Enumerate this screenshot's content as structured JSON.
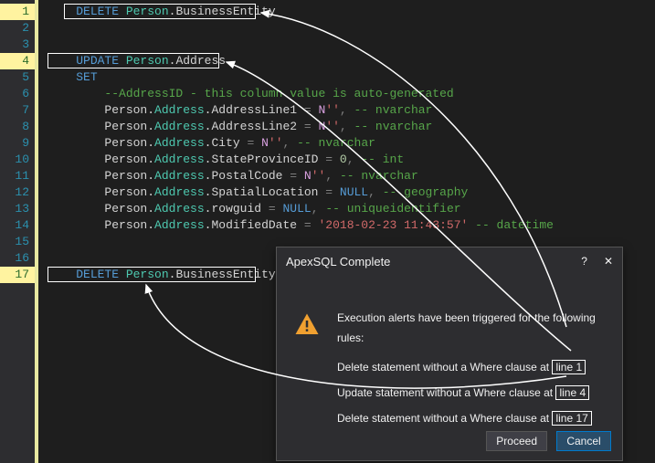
{
  "editor": {
    "lines": [
      {
        "n": 1,
        "hl": true,
        "parts": [
          [
            "    ",
            "kw-white"
          ],
          [
            "DELETE ",
            "kw-blue"
          ],
          [
            "Person",
            "kw-green"
          ],
          [
            ".",
            "kw-white"
          ],
          [
            "BusinessEntity",
            "kw-white"
          ]
        ]
      },
      {
        "n": 2,
        "hl": false,
        "parts": []
      },
      {
        "n": 3,
        "hl": false,
        "parts": []
      },
      {
        "n": 4,
        "hl": true,
        "parts": [
          [
            "    ",
            "kw-white"
          ],
          [
            "UPDATE ",
            "kw-blue"
          ],
          [
            "Person",
            "kw-green"
          ],
          [
            ".",
            "kw-white"
          ],
          [
            "Address",
            "kw-white"
          ]
        ]
      },
      {
        "n": 5,
        "hl": false,
        "parts": [
          [
            "    ",
            "kw-white"
          ],
          [
            "SET",
            "kw-blue"
          ]
        ]
      },
      {
        "n": 6,
        "hl": false,
        "parts": [
          [
            "        ",
            "kw-white"
          ],
          [
            "--AddressID - this column value is auto-generated",
            "kw-comment"
          ]
        ]
      },
      {
        "n": 7,
        "hl": false,
        "parts": [
          [
            "        ",
            "kw-white"
          ],
          [
            "Person",
            "kw-white"
          ],
          [
            ".",
            "kw-white"
          ],
          [
            "Address",
            "kw-green"
          ],
          [
            ".",
            "kw-white"
          ],
          [
            "AddressLine1 ",
            "kw-white"
          ],
          [
            "= ",
            "kw-gray"
          ],
          [
            "N",
            "kw-mag"
          ],
          [
            "''",
            "kw-red"
          ],
          [
            ", ",
            "kw-gray"
          ],
          [
            "-- nvarchar",
            "kw-comment"
          ]
        ]
      },
      {
        "n": 8,
        "hl": false,
        "parts": [
          [
            "        ",
            "kw-white"
          ],
          [
            "Person",
            "kw-white"
          ],
          [
            ".",
            "kw-white"
          ],
          [
            "Address",
            "kw-green"
          ],
          [
            ".",
            "kw-white"
          ],
          [
            "AddressLine2 ",
            "kw-white"
          ],
          [
            "= ",
            "kw-gray"
          ],
          [
            "N",
            "kw-mag"
          ],
          [
            "''",
            "kw-red"
          ],
          [
            ", ",
            "kw-gray"
          ],
          [
            "-- nvarchar",
            "kw-comment"
          ]
        ]
      },
      {
        "n": 9,
        "hl": false,
        "parts": [
          [
            "        ",
            "kw-white"
          ],
          [
            "Person",
            "kw-white"
          ],
          [
            ".",
            "kw-white"
          ],
          [
            "Address",
            "kw-green"
          ],
          [
            ".",
            "kw-white"
          ],
          [
            "City ",
            "kw-white"
          ],
          [
            "= ",
            "kw-gray"
          ],
          [
            "N",
            "kw-mag"
          ],
          [
            "''",
            "kw-red"
          ],
          [
            ", ",
            "kw-gray"
          ],
          [
            "-- nvarchar",
            "kw-comment"
          ]
        ]
      },
      {
        "n": 10,
        "hl": false,
        "parts": [
          [
            "        ",
            "kw-white"
          ],
          [
            "Person",
            "kw-white"
          ],
          [
            ".",
            "kw-white"
          ],
          [
            "Address",
            "kw-green"
          ],
          [
            ".",
            "kw-white"
          ],
          [
            "StateProvinceID ",
            "kw-white"
          ],
          [
            "= ",
            "kw-gray"
          ],
          [
            "0",
            "kw-num"
          ],
          [
            ", ",
            "kw-gray"
          ],
          [
            "-- int",
            "kw-comment"
          ]
        ]
      },
      {
        "n": 11,
        "hl": false,
        "parts": [
          [
            "        ",
            "kw-white"
          ],
          [
            "Person",
            "kw-white"
          ],
          [
            ".",
            "kw-white"
          ],
          [
            "Address",
            "kw-green"
          ],
          [
            ".",
            "kw-white"
          ],
          [
            "PostalCode ",
            "kw-white"
          ],
          [
            "= ",
            "kw-gray"
          ],
          [
            "N",
            "kw-mag"
          ],
          [
            "''",
            "kw-red"
          ],
          [
            ", ",
            "kw-gray"
          ],
          [
            "-- nvarchar",
            "kw-comment"
          ]
        ]
      },
      {
        "n": 12,
        "hl": false,
        "parts": [
          [
            "        ",
            "kw-white"
          ],
          [
            "Person",
            "kw-white"
          ],
          [
            ".",
            "kw-white"
          ],
          [
            "Address",
            "kw-green"
          ],
          [
            ".",
            "kw-white"
          ],
          [
            "SpatialLocation ",
            "kw-white"
          ],
          [
            "= ",
            "kw-gray"
          ],
          [
            "NULL",
            "kw-blue"
          ],
          [
            ", ",
            "kw-gray"
          ],
          [
            "-- geography",
            "kw-comment"
          ]
        ]
      },
      {
        "n": 13,
        "hl": false,
        "parts": [
          [
            "        ",
            "kw-white"
          ],
          [
            "Person",
            "kw-white"
          ],
          [
            ".",
            "kw-white"
          ],
          [
            "Address",
            "kw-green"
          ],
          [
            ".",
            "kw-white"
          ],
          [
            "rowguid ",
            "kw-white"
          ],
          [
            "= ",
            "kw-gray"
          ],
          [
            "NULL",
            "kw-blue"
          ],
          [
            ", ",
            "kw-gray"
          ],
          [
            "-- uniqueidentifier",
            "kw-comment"
          ]
        ]
      },
      {
        "n": 14,
        "hl": false,
        "parts": [
          [
            "        ",
            "kw-white"
          ],
          [
            "Person",
            "kw-white"
          ],
          [
            ".",
            "kw-white"
          ],
          [
            "Address",
            "kw-green"
          ],
          [
            ".",
            "kw-white"
          ],
          [
            "ModifiedDate ",
            "kw-white"
          ],
          [
            "= ",
            "kw-gray"
          ],
          [
            "'2018-02-23 11:43:57'",
            "kw-red"
          ],
          [
            " ",
            "kw-white"
          ],
          [
            "-- datetime",
            "kw-comment"
          ]
        ]
      },
      {
        "n": 15,
        "hl": false,
        "parts": []
      },
      {
        "n": 16,
        "hl": false,
        "parts": []
      },
      {
        "n": 17,
        "hl": true,
        "parts": [
          [
            "    ",
            "kw-white"
          ],
          [
            "DELETE ",
            "kw-blue"
          ],
          [
            "Person",
            "kw-green"
          ],
          [
            ".",
            "kw-white"
          ],
          [
            "BusinessEntity",
            "kw-white"
          ]
        ]
      }
    ]
  },
  "dialog": {
    "title": "ApexSQL Complete",
    "help": "?",
    "close": "✕",
    "intro": "Execution alerts have been triggered for the following rules:",
    "rules": [
      {
        "text": "Delete statement without a Where clause at ",
        "ref": "line 1"
      },
      {
        "text": "Update statement without a Where clause at ",
        "ref": "line 4"
      },
      {
        "text": "Delete statement without a Where clause at ",
        "ref": "line 17"
      }
    ],
    "proceed": "Proceed",
    "cancel": "Cancel"
  }
}
